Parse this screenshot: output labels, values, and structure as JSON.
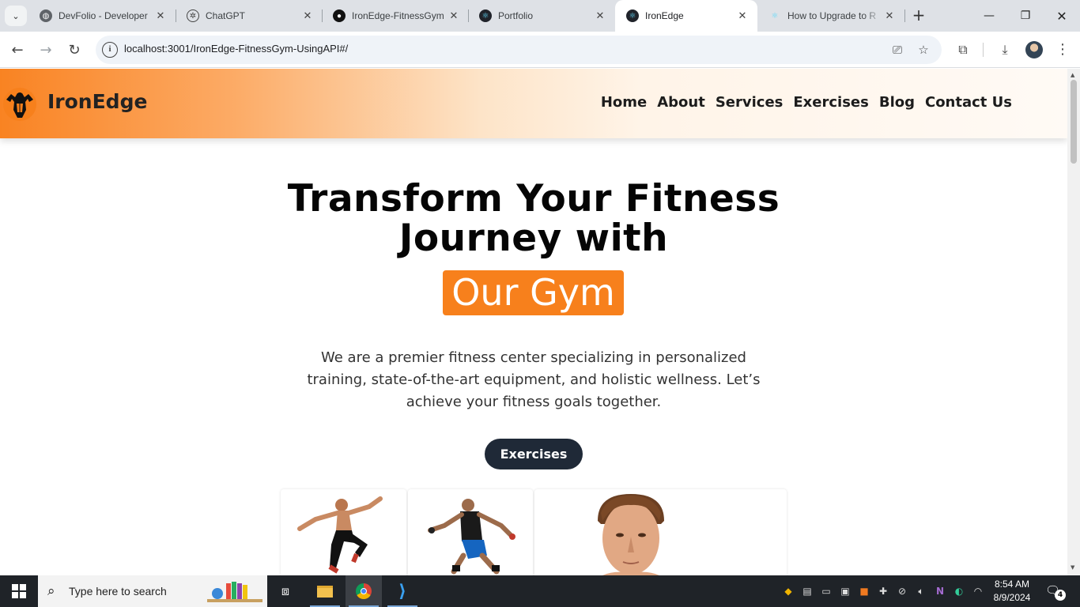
{
  "browser": {
    "tabs": [
      {
        "title": "DevFolio - Developer",
        "icon": "globe-icon"
      },
      {
        "title": "ChatGPT",
        "icon": "chatgpt-icon"
      },
      {
        "title": "IronEdge-FitnessGym",
        "icon": "github-icon"
      },
      {
        "title": "Portfolio",
        "icon": "react-icon"
      },
      {
        "title": "IronEdge",
        "icon": "react-icon"
      },
      {
        "title": "How to Upgrade to R",
        "icon": "react-icon"
      }
    ],
    "address": "localhost:3001/IronEdge-FitnessGym-UsingAPI#/"
  },
  "site": {
    "brand": "IronEdge",
    "nav": [
      "Home",
      "About",
      "Services",
      "Exercises",
      "Blog",
      "Contact Us"
    ],
    "hero": {
      "title_line1": "Transform Your Fitness",
      "title_line2": "Journey with",
      "highlight": "Our Gym",
      "description": "We are a premier fitness center specializing in personalized training, state-of-the-art equipment, and holistic wellness. Let’s achieve your fitness goals together.",
      "button": "Exercises"
    },
    "colors": {
      "accent": "#f7801c",
      "button_bg": "#1f2937"
    }
  },
  "taskbar": {
    "search_placeholder": "Type here to search",
    "time": "8:54 AM",
    "date": "8/9/2024",
    "notifications": "4"
  }
}
